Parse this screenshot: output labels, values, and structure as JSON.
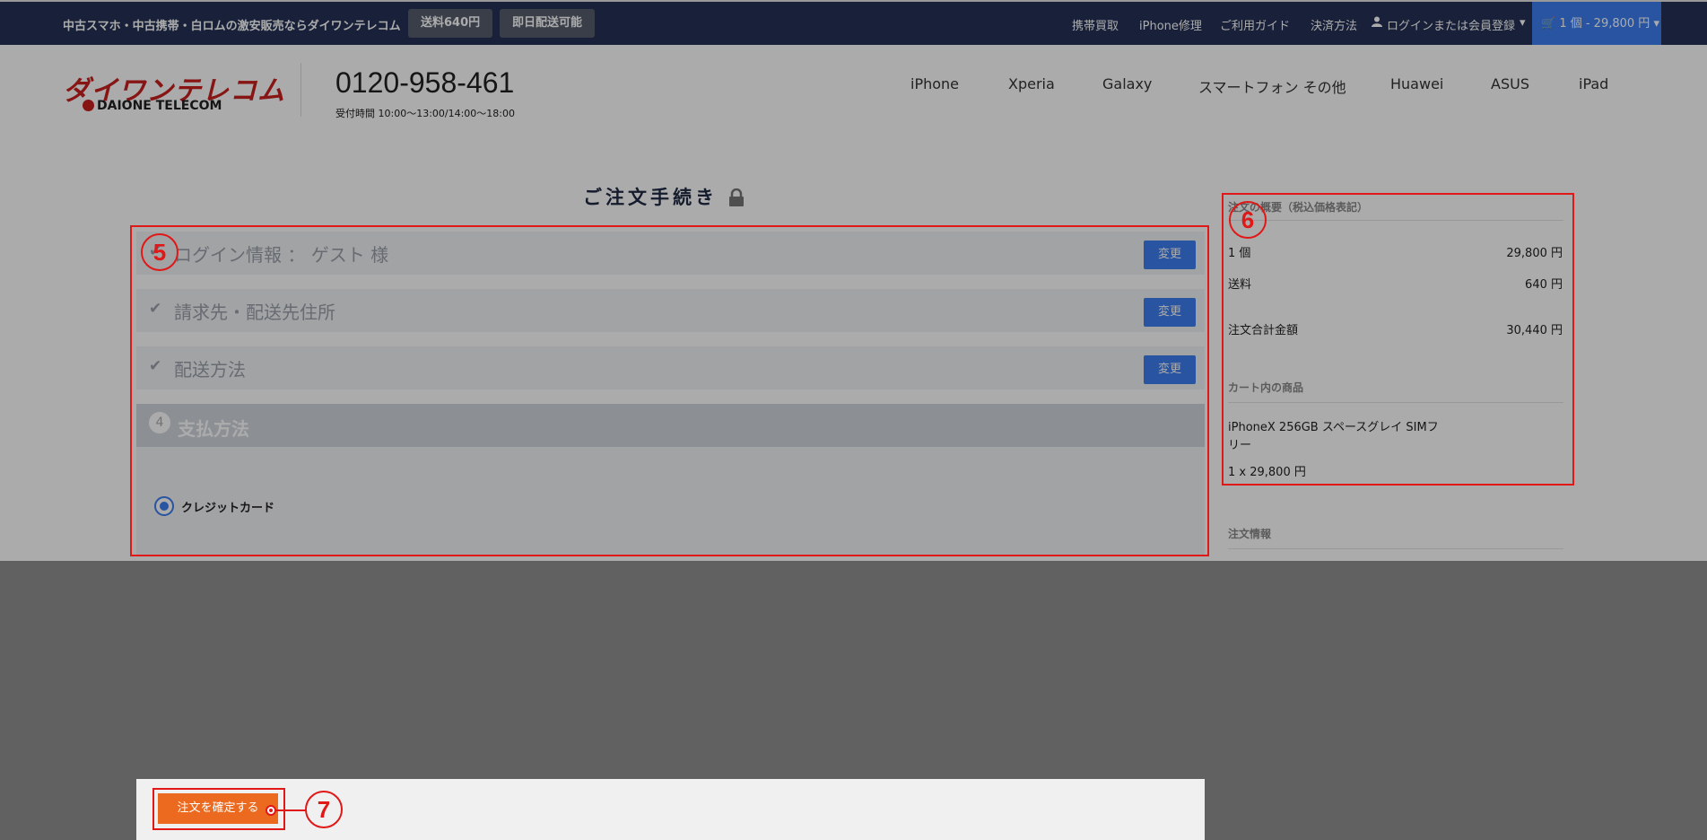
{
  "topbar": {
    "tagline": "中古スマホ・中古携帯・白ロムの激安販売ならダイワンテレコム",
    "badge_shipping": "送料640円",
    "badge_instant": "即日配送可能",
    "nav": [
      "携帯買取",
      "iPhone修理",
      "ご利用ガイド",
      "決済方法"
    ],
    "login": "ログインまたは会員登録",
    "cart": "1 個 - 29,800 円"
  },
  "header": {
    "logo": "ダイワンテレコム",
    "logo_sub": "DAIONE TELECOM",
    "phone": "0120-958-461",
    "hours": "受付時間 10:00〜13:00/14:00〜18:00",
    "nav": [
      "iPhone",
      "Xperia",
      "Galaxy",
      "スマートフォン その他",
      "Huawei",
      "ASUS",
      "iPad"
    ]
  },
  "checkout": {
    "title": "ご注文手続き",
    "steps": [
      {
        "label": "ログイン情報 ： ゲスト 様",
        "button": "変更"
      },
      {
        "label": "請求先・配送先住所",
        "button": "変更"
      },
      {
        "label": "配送方法",
        "button": "変更"
      }
    ],
    "active_step": {
      "number": "4",
      "label": "支払方法"
    },
    "payment_option": "クレジットカード"
  },
  "summary": {
    "heading": "注文の概要（税込価格表記）",
    "rows": [
      {
        "label": "1 個",
        "value": "29,800 円"
      },
      {
        "label": "送料",
        "value": "640 円"
      },
      {
        "label": "注文合計金額",
        "value": "30,440 円"
      }
    ],
    "cart_heading": "カート内の商品",
    "item_name": "iPhoneX 256GB スペースグレイ SIMフリー",
    "item_qty": "1 x 29,800 円",
    "order_info": "注文情報"
  },
  "confirm_button": "注文を確定する",
  "annotations": {
    "n5": "5",
    "n6": "6",
    "n7": "7"
  },
  "colors": {
    "accent": "#3d7ef0",
    "topbar": "#243255",
    "confirm": "#ec6a1f",
    "annotation": "#e01818"
  }
}
